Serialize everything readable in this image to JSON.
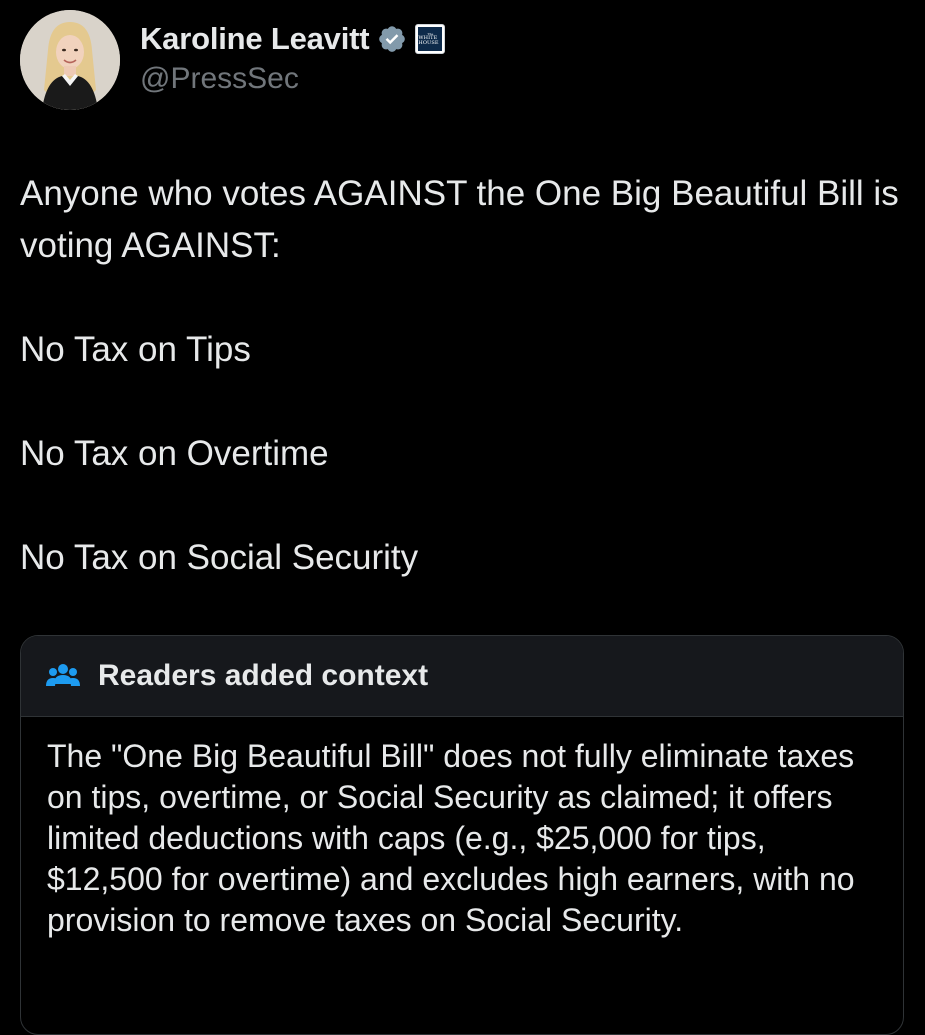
{
  "author": {
    "display_name": "Karoline Leavitt",
    "handle": "@PressSec",
    "affiliate_badge_text": "WHITE HOUSE"
  },
  "tweet": {
    "intro": "Anyone who votes AGAINST the One Big Beautiful Bill is voting AGAINST:",
    "items": [
      "No Tax on Tips",
      "No Tax on Overtime",
      "No Tax on Social Security"
    ]
  },
  "community_note": {
    "title": "Readers added context",
    "body": "The \"One Big Beautiful Bill\" does not fully eliminate taxes on tips, overtime, or Social Security as claimed; it offers limited deductions with caps (e.g., $25,000 for tips, $12,500 for overtime) and excludes high earners, with no provision to remove taxes on Social Security."
  },
  "icons": {
    "verified": "verified-badge-icon",
    "affiliate": "white-house-affiliate-icon",
    "note": "people-icon"
  },
  "colors": {
    "background": "#000000",
    "text_primary": "#e7e9ea",
    "text_secondary": "#71767b",
    "verified_badge": "#829aab",
    "note_icon": "#1d9bf0",
    "note_header_bg": "#16181c",
    "border": "#2f3336"
  }
}
